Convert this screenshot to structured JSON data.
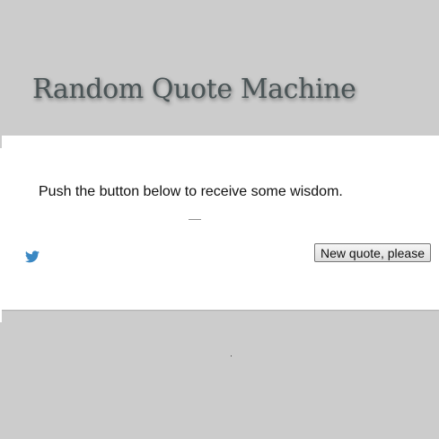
{
  "header": {
    "title": "Random Quote Machine"
  },
  "quote": {
    "text": "Push the button below to receive some wisdom.",
    "author": "—"
  },
  "actions": {
    "tweet_icon": "twitter-bird-icon",
    "new_quote_label": "New quote, please"
  },
  "colors": {
    "background": "#cccccc",
    "card": "#ffffff",
    "title": "#4a5456",
    "twitter_blue": "#3b88c3"
  }
}
